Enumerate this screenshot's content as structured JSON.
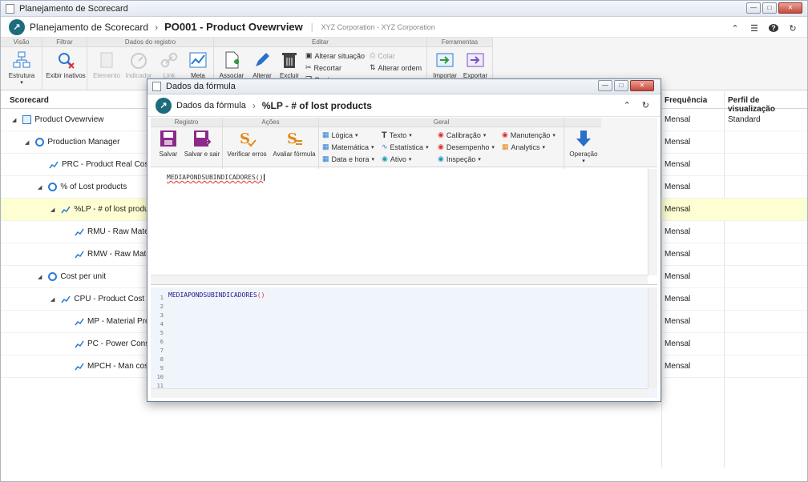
{
  "window": {
    "title": "Planejamento de Scorecard"
  },
  "header": {
    "app": "Planejamento de Scorecard",
    "title": "PO001 - Product Ovewrview",
    "subtitle": "XYZ Corporation - XYZ Corporation"
  },
  "ribbon": {
    "groups": {
      "visao": "Visão",
      "filtrar": "Filtrar",
      "dados": "Dados do registro",
      "editar": "Editar",
      "ferramentas": "Ferramentas"
    },
    "buttons": {
      "estrutura": "Estrutura",
      "exibir": "Exibir inativos",
      "elemento": "Elemento",
      "indicador": "Indicador",
      "link": "Link",
      "meta": "Meta",
      "associar": "Associar",
      "alterar": "Alterar",
      "excluir": "Excluir",
      "importar": "Importar",
      "exportar": "Exportar"
    },
    "small": {
      "alterar_situacao": "Alterar situação",
      "recortar": "Recortar",
      "copiar": "Copiar",
      "colar": "Colar",
      "alterar_ordem": "Alterar ordem"
    }
  },
  "grid": {
    "headers": {
      "scorecard": "Scorecard",
      "frequencia": "Frequência",
      "perfil": "Perfil de visualização"
    },
    "rows": [
      {
        "label": "Product Ovewrview",
        "freq": "Mensal",
        "prof": "Standard"
      },
      {
        "label": "Production Manager",
        "freq": "Mensal",
        "prof": ""
      },
      {
        "label": "PRC - Product Real Cost",
        "freq": "Mensal",
        "prof": ""
      },
      {
        "label": "% of Lost products",
        "freq": "Mensal",
        "prof": ""
      },
      {
        "label": "%LP - # of lost products",
        "freq": "Mensal",
        "prof": ""
      },
      {
        "label": "RMU - Raw Materia",
        "freq": "Mensal",
        "prof": ""
      },
      {
        "label": "RMW - Raw Materia",
        "freq": "Mensal",
        "prof": ""
      },
      {
        "label": "Cost per unit",
        "freq": "Mensal",
        "prof": ""
      },
      {
        "label": "CPU - Product Cost",
        "freq": "Mensal",
        "prof": ""
      },
      {
        "label": "MP - Material Produ",
        "freq": "Mensal",
        "prof": ""
      },
      {
        "label": "PC - Power Consum",
        "freq": "Mensal",
        "prof": ""
      },
      {
        "label": "MPCH - Man cost pe",
        "freq": "Mensal",
        "prof": ""
      }
    ]
  },
  "dialog": {
    "title": "Dados da fórmula",
    "breadcrumb": "Dados da fórmula",
    "heading": "%LP - # of lost products",
    "groups": {
      "registro": "Registro",
      "acoes": "Ações",
      "geral": "Geral"
    },
    "buttons": {
      "salvar": "Salvar",
      "salvar_sair": "Salvar e sair",
      "verificar": "Verificar erros",
      "avaliar": "Avaliar fórmula",
      "operacao": "Operação"
    },
    "menus": {
      "logica": "Lógica",
      "matematica": "Matemática",
      "data_hora": "Data e hora",
      "texto": "Texto",
      "estatistica": "Estatística",
      "ativo": "Ativo",
      "calibracao": "Calibração",
      "desempenho": "Desempenho",
      "inspecao": "Inspeção",
      "manutencao": "Manutenção",
      "analytics": "Analytics"
    },
    "formula_text": "MEDIAPONDSUBINDICADORES()",
    "preview_func": "MEDIAPONDSUBINDICADORES",
    "preview_parens": "()",
    "line_numbers": [
      "1",
      "2",
      "3",
      "4",
      "5",
      "6",
      "7",
      "8",
      "9",
      "10",
      "11"
    ]
  },
  "colors": {
    "accent": "#1d6b7d",
    "selected_row": "#fefed3",
    "icon_blue": "#2a7bd1"
  }
}
